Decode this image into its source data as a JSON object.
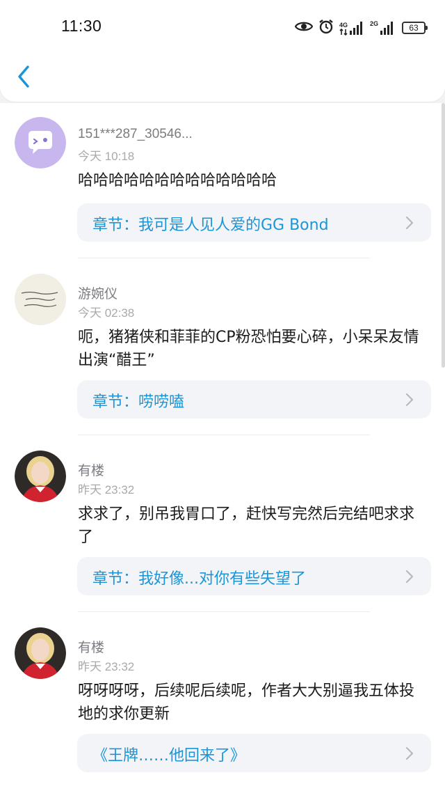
{
  "status_bar": {
    "time": "11:30",
    "network_1": "4G",
    "network_2": "2G",
    "battery": "63",
    "icons": [
      "eye-icon",
      "alarm-icon",
      "signal-4g-icon",
      "signal-2g-icon",
      "battery-icon"
    ]
  },
  "header": {
    "back_icon": "chevron-left-icon"
  },
  "colors": {
    "accent": "#1a95d8",
    "username": "#7b7b82",
    "timestamp": "#a9a9ae",
    "chapter_bg": "#f3f4f7"
  },
  "comments": [
    {
      "username": "151***287_30546...",
      "time": "今天 10:18",
      "text": "哈哈哈哈哈哈哈哈哈哈哈哈哈",
      "chapter": "章节：我可是人见人爱的GG Bond",
      "avatar": "purple-chat-bubble-avatar"
    },
    {
      "username": "游婉仪",
      "time": "今天 02:38",
      "text": "呃，猪猪侠和菲菲的CP粉恐怕要心碎，小呆呆友情出演“醋王”",
      "chapter": "章节：唠唠嗑",
      "avatar": "handwriting-avatar",
      "avatar_text": "有些事情我不说，不是我不在乎，只是我太善良。"
    },
    {
      "username": "有楼",
      "time": "昨天 23:32",
      "text": "求求了，别吊我胃口了，赶快写完然后完结吧求求了",
      "chapter": "章节：我好像...对你有些失望了",
      "avatar": "portrait-avatar"
    },
    {
      "username": "有楼",
      "time": "昨天 23:32",
      "text": "呀呀呀呀，后续呢后续呢，作者大大别逼我五体投地的求你更新",
      "chapter": "《王牌……他回来了》",
      "avatar": "portrait-avatar"
    }
  ]
}
